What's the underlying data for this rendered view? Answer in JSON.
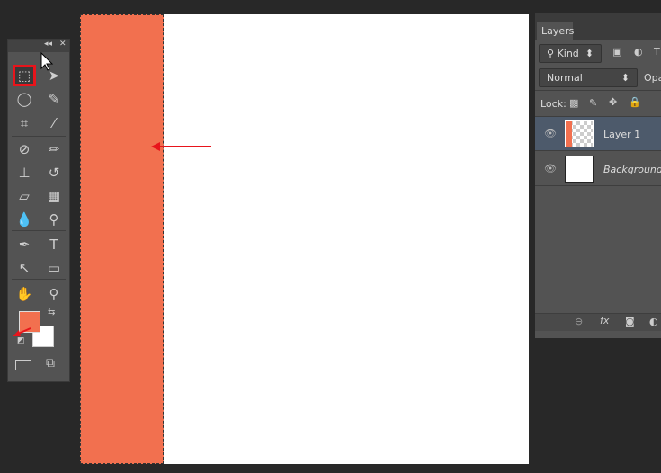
{
  "colors": {
    "foreground": "#f2704f",
    "background": "#ffffff",
    "selection_fill": "#f2704f",
    "annotation": "#e8141b",
    "layer_selected": "#4d5a6b"
  },
  "toolbar": {
    "collapse": "◂◂",
    "close": "✕",
    "tools": [
      {
        "name": "rectangular-marquee",
        "glyph": "⬚",
        "active": true
      },
      {
        "name": "move",
        "glyph": "➤"
      },
      {
        "name": "lasso",
        "glyph": "◯"
      },
      {
        "name": "quick-selection",
        "glyph": "✎"
      },
      {
        "name": "crop",
        "glyph": "⌗"
      },
      {
        "name": "eyedropper",
        "glyph": "⁄"
      },
      {
        "name": "spot-healing",
        "glyph": "⊘"
      },
      {
        "name": "brush",
        "glyph": "✏"
      },
      {
        "name": "clone-stamp",
        "glyph": "⊥"
      },
      {
        "name": "history-brush",
        "glyph": "↺"
      },
      {
        "name": "eraser",
        "glyph": "▱"
      },
      {
        "name": "gradient",
        "glyph": "▦"
      },
      {
        "name": "blur",
        "glyph": "💧"
      },
      {
        "name": "dodge",
        "glyph": "⚲"
      },
      {
        "name": "pen",
        "glyph": "✒"
      },
      {
        "name": "type",
        "glyph": "T"
      },
      {
        "name": "path-selection",
        "glyph": "↖"
      },
      {
        "name": "rectangle",
        "glyph": "▭"
      },
      {
        "name": "hand",
        "glyph": "✋"
      },
      {
        "name": "zoom",
        "glyph": "⚲"
      }
    ]
  },
  "layers_panel": {
    "tab": "Layers",
    "filter": "Kind",
    "blend_mode": "Normal",
    "opacity_label": "Opa",
    "lock_label": "Lock:",
    "layers": [
      {
        "name": "Layer 1",
        "selected": true
      },
      {
        "name": "Background",
        "selected": false
      }
    ],
    "footer": {
      "link": "⊖",
      "fx": "fx"
    }
  }
}
